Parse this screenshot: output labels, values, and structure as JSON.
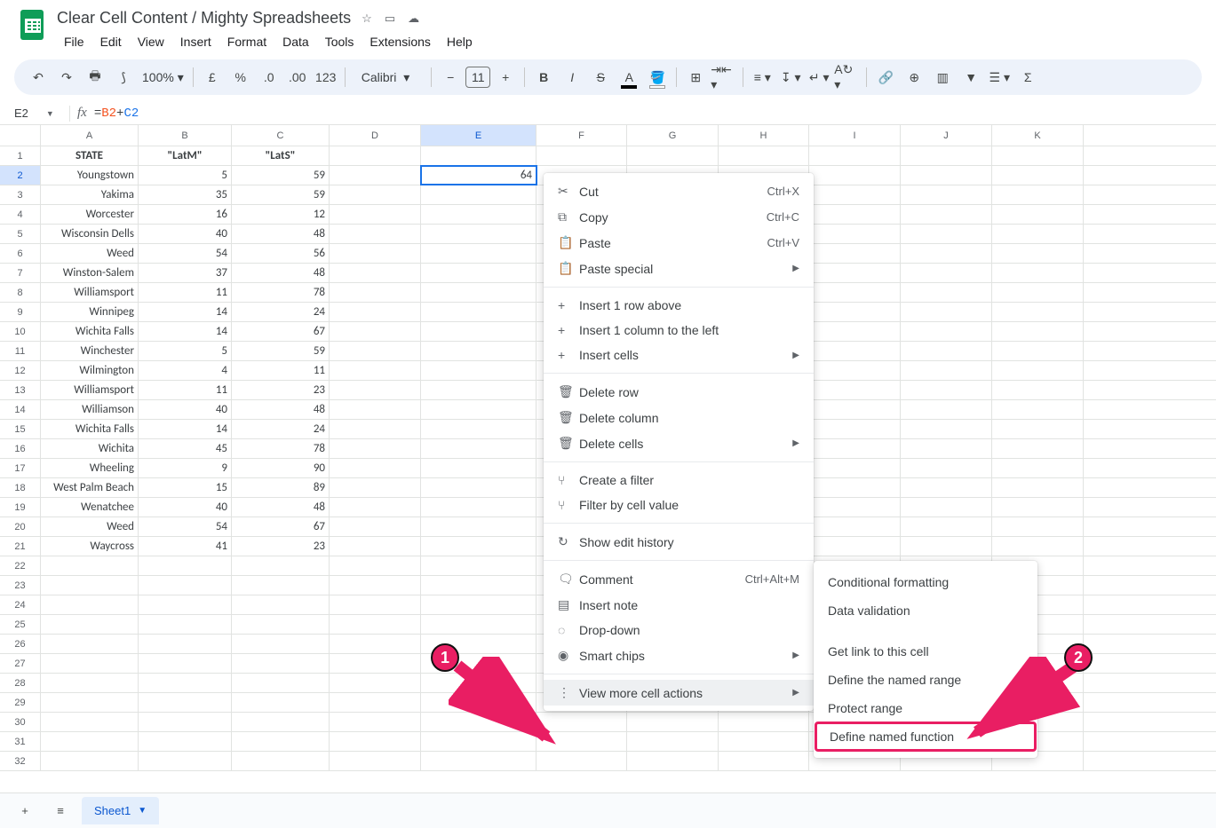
{
  "doc": {
    "title": "Clear Cell Content / Mighty Spreadsheets"
  },
  "menubar": [
    "File",
    "Edit",
    "View",
    "Insert",
    "Format",
    "Data",
    "Tools",
    "Extensions",
    "Help"
  ],
  "toolbar": {
    "zoom": "100%",
    "font": "Calibri",
    "font_size": "11"
  },
  "namebox": "E2",
  "formula": {
    "prefix": "=",
    "ref1": "B2",
    "op": "+",
    "ref2": "C2"
  },
  "columns": [
    "A",
    "B",
    "C",
    "D",
    "E",
    "F",
    "G",
    "H",
    "I",
    "J",
    "K"
  ],
  "col_widths": [
    "wA",
    "wB",
    "wC",
    "wD",
    "wE",
    "wF",
    "wG",
    "wH",
    "wI",
    "wJ",
    "wK"
  ],
  "selected_col_index": 4,
  "header_row": [
    "STATE",
    "\"LatM\"",
    "\"LatS\"",
    "",
    "",
    "",
    "",
    "",
    "",
    "",
    ""
  ],
  "selected_cell": {
    "row": 2,
    "col": "E",
    "value": "64"
  },
  "data_rows": [
    [
      "Youngstown",
      "5",
      "59"
    ],
    [
      "Yakima",
      "35",
      "59"
    ],
    [
      "Worcester",
      "16",
      "12"
    ],
    [
      "Wisconsin Dells",
      "40",
      "48"
    ],
    [
      "Weed",
      "54",
      "56"
    ],
    [
      "Winston-Salem",
      "37",
      "48"
    ],
    [
      "Williamsport",
      "11",
      "78"
    ],
    [
      "Winnipeg",
      "14",
      "24"
    ],
    [
      "Wichita Falls",
      "14",
      "67"
    ],
    [
      "Winchester",
      "5",
      "59"
    ],
    [
      "Wilmington",
      "4",
      "11"
    ],
    [
      "Williamsport",
      "11",
      "23"
    ],
    [
      "Williamson",
      "40",
      "48"
    ],
    [
      "Wichita Falls",
      "14",
      "24"
    ],
    [
      "Wichita",
      "45",
      "78"
    ],
    [
      "Wheeling",
      "9",
      "90"
    ],
    [
      "West Palm Beach",
      "15",
      "89"
    ],
    [
      "Wenatchee",
      "40",
      "48"
    ],
    [
      "Weed",
      "54",
      "67"
    ],
    [
      "Waycross",
      "41",
      "23"
    ]
  ],
  "empty_rows": 11,
  "context_menu": {
    "groups": [
      [
        {
          "icon": "cut",
          "label": "Cut",
          "shortcut": "Ctrl+X"
        },
        {
          "icon": "copy",
          "label": "Copy",
          "shortcut": "Ctrl+C"
        },
        {
          "icon": "paste",
          "label": "Paste",
          "shortcut": "Ctrl+V"
        },
        {
          "icon": "paste",
          "label": "Paste special",
          "arrow": true
        }
      ],
      [
        {
          "icon": "plus",
          "label": "Insert 1 row above"
        },
        {
          "icon": "plus",
          "label": "Insert 1 column to the left"
        },
        {
          "icon": "plus",
          "label": "Insert cells",
          "arrow": true
        }
      ],
      [
        {
          "icon": "trash",
          "label": "Delete row"
        },
        {
          "icon": "trash",
          "label": "Delete column"
        },
        {
          "icon": "trash",
          "label": "Delete cells",
          "arrow": true
        }
      ],
      [
        {
          "icon": "filter",
          "label": "Create a filter"
        },
        {
          "icon": "filter",
          "label": "Filter by cell value"
        }
      ],
      [
        {
          "icon": "history",
          "label": "Show edit history"
        }
      ],
      [
        {
          "icon": "comment",
          "label": "Comment",
          "shortcut": "Ctrl+Alt+M"
        },
        {
          "icon": "note",
          "label": "Insert note"
        },
        {
          "icon": "dropdown",
          "label": "Drop-down"
        },
        {
          "icon": "chip",
          "label": "Smart chips",
          "arrow": true
        }
      ],
      [
        {
          "icon": "more",
          "label": "View more cell actions",
          "arrow": true,
          "highlight": true
        }
      ]
    ]
  },
  "submenu": [
    {
      "label": "Conditional formatting"
    },
    {
      "label": "Data validation"
    },
    {
      "label": "Get link to this cell",
      "gap": true
    },
    {
      "label": "Define the named range"
    },
    {
      "label": "Protect range"
    },
    {
      "label": "Define named function",
      "highlighted": true
    }
  ],
  "annotations": {
    "badge1": "1",
    "badge2": "2"
  },
  "sheet_tab": "Sheet1"
}
